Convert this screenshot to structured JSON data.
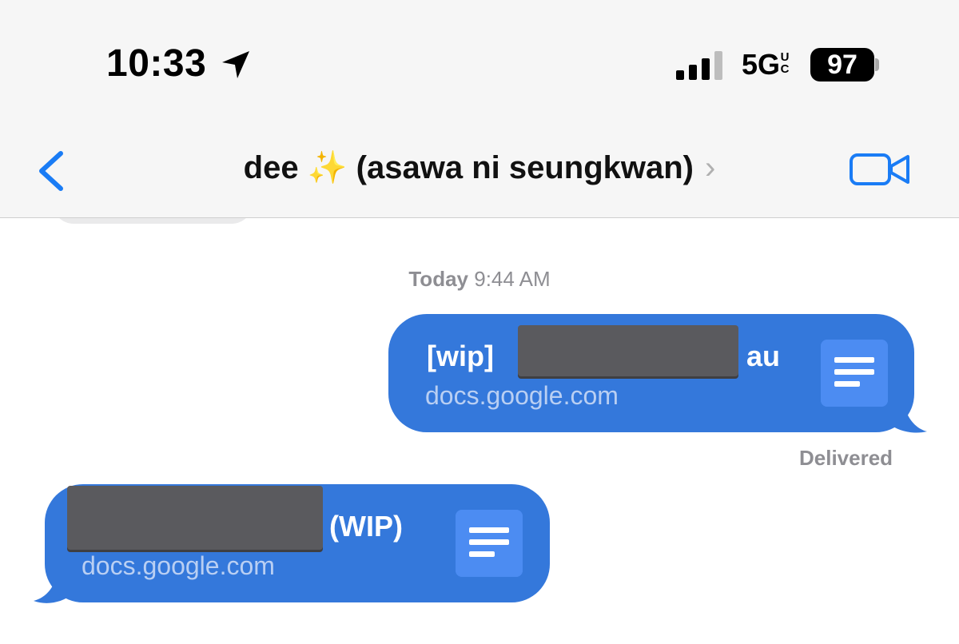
{
  "status_bar": {
    "time": "10:33",
    "network": "5G",
    "network_superscript_top": "U",
    "network_superscript_bottom": "C",
    "battery": "97"
  },
  "nav": {
    "contact_name": "dee",
    "contact_emoji": "✨",
    "contact_suffix": "(asawa ni seungkwan)",
    "chevron": "›"
  },
  "conversation": {
    "timestamp_day": "Today",
    "timestamp_time": "9:44 AM",
    "messages": [
      {
        "sender": "me",
        "title_prefix": "[wip]",
        "title_suffix": "au",
        "url": "docs.google.com",
        "icon": "document-icon"
      },
      {
        "sender": "them",
        "title_suffix": "(WIP)",
        "url": "docs.google.com",
        "icon": "document-icon"
      }
    ],
    "delivered_label": "Delivered"
  },
  "colors": {
    "bubble": "#3478db",
    "accent": "#1a7cf5",
    "meta_text": "#8e8e93"
  }
}
